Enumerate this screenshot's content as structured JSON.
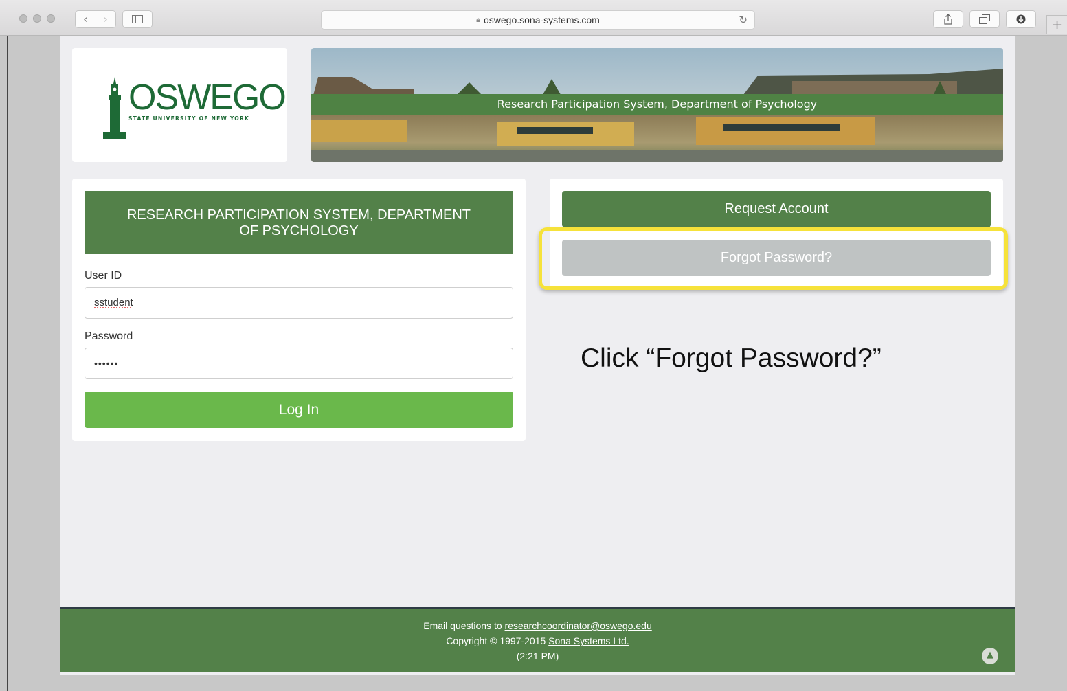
{
  "browser": {
    "url": "oswego.sona-systems.com",
    "icons": {
      "back": "chevron-left-icon",
      "forward": "chevron-right-icon",
      "sidebar": "sidebar-icon",
      "lock": "lock-icon",
      "reload": "reload-icon",
      "share": "share-icon",
      "tabs": "tabs-icon",
      "downloads": "download-icon",
      "new_tab": "plus-icon"
    },
    "new_tab_glyph": "+"
  },
  "header": {
    "logo": {
      "wordmark": "OSWEGO",
      "subtitle": "STATE UNIVERSITY OF NEW YORK"
    },
    "banner_title": "Research Participation System, Department of Psychology"
  },
  "login": {
    "heading": "RESEARCH PARTICIPATION SYSTEM, DEPARTMENT OF PSYCHOLOGY",
    "user_id_label": "User ID",
    "user_id_value": "sstudent",
    "password_label": "Password",
    "password_value": "••••••",
    "login_button": "Log In"
  },
  "account": {
    "request_button": "Request Account",
    "forgot_button": "Forgot Password?"
  },
  "annotation": {
    "instruction": "Click “Forgot Password?”",
    "highlight_color": "#f6e23a"
  },
  "footer": {
    "email_prefix": "Email questions to ",
    "email": "researchcoordinator@oswego.edu",
    "copyright_prefix": "Copyright © 1997-2015 ",
    "company": "Sona Systems Ltd.",
    "time": "(2:21 PM)"
  },
  "colors": {
    "brand_green": "#538149",
    "login_green": "#6ab84b",
    "forgot_gray": "#bfc3c3",
    "logo_green": "#1e6a36"
  }
}
